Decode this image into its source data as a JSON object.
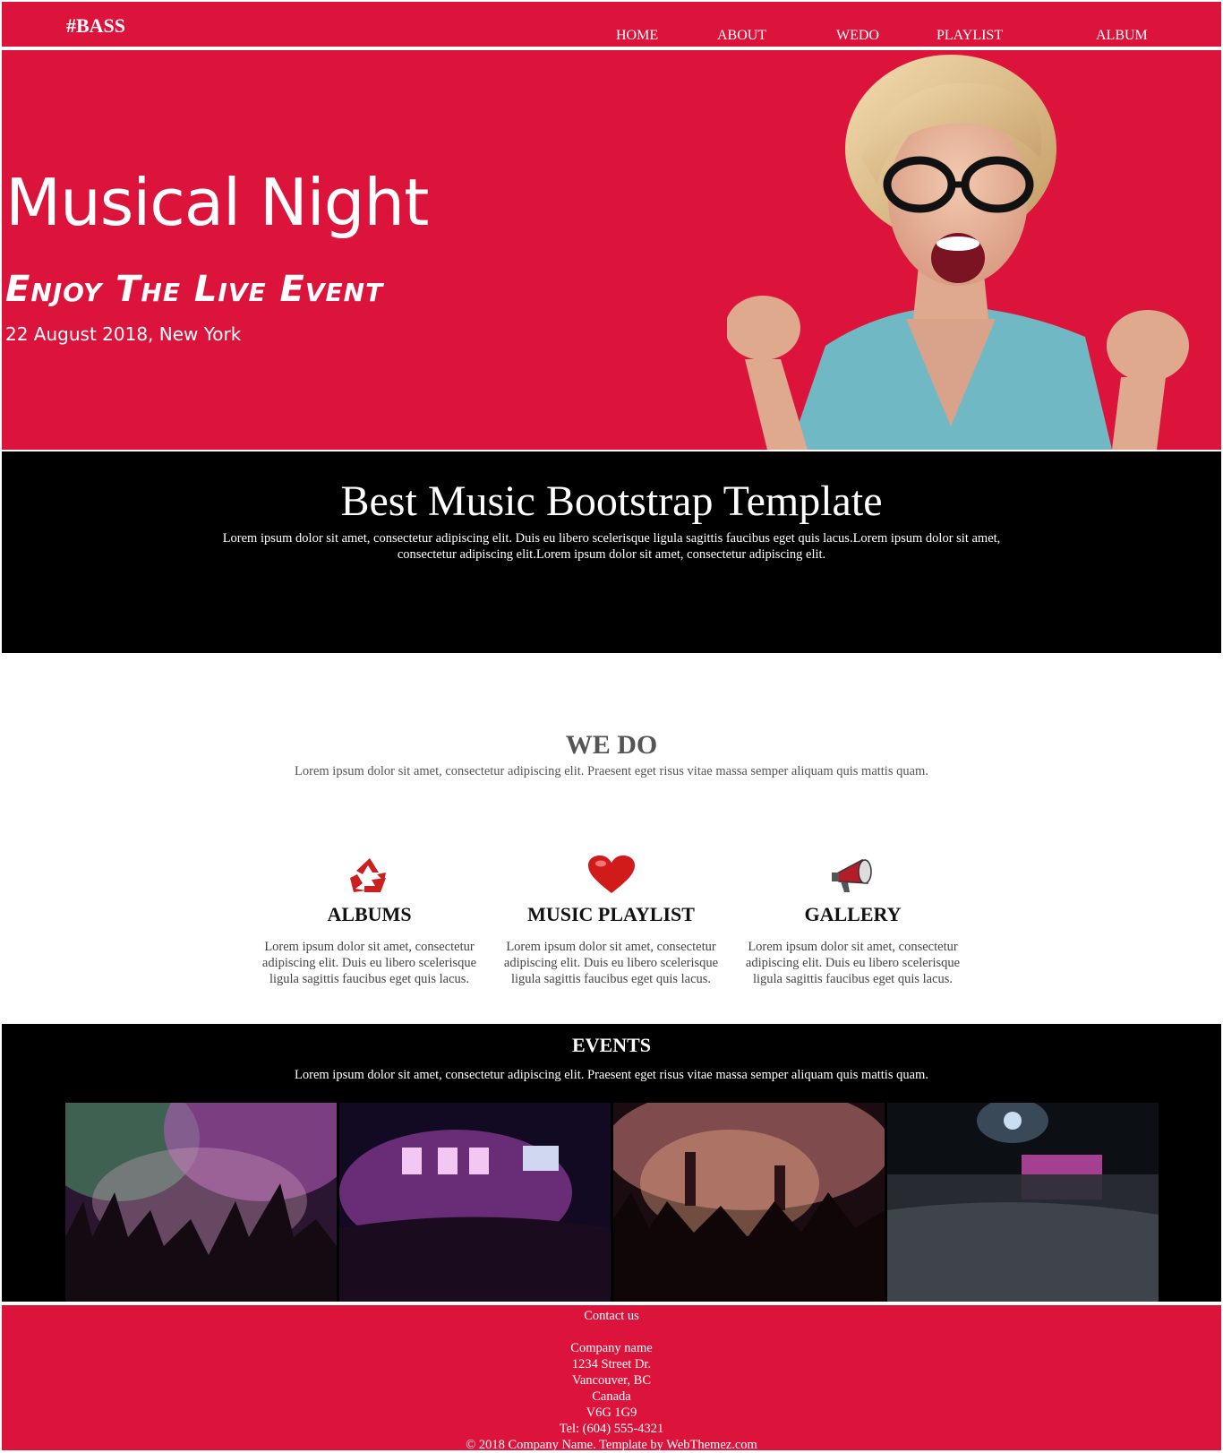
{
  "nav": {
    "brand": "#BASS",
    "links": [
      "HOME",
      "ABOUT",
      "WEDO",
      "PLAYLIST",
      "ALBUM"
    ]
  },
  "hero": {
    "title": "Musical Night",
    "subtitle": "Enjoy The Live Event",
    "date": "22 August 2018, New York"
  },
  "intro": {
    "title": "Best Music Bootstrap Template",
    "text": "Lorem ipsum dolor sit amet, consectetur adipiscing elit. Duis eu libero scelerisque ligula sagittis faucibus eget quis lacus.Lorem ipsum dolor sit amet, consectetur adipiscing elit.Lorem ipsum dolor sit amet, consectetur adipiscing elit."
  },
  "wedo": {
    "title": "WE DO",
    "text": "Lorem ipsum dolor sit amet, consectetur adipiscing elit. Praesent eget risus vitae massa semper aliquam quis mattis quam.",
    "features": [
      {
        "icon": "recycle-icon",
        "title": "ALBUMS",
        "text": "Lorem ipsum dolor sit amet, consectetur adipiscing elit. Duis eu libero scelerisque ligula sagittis faucibus eget quis lacus."
      },
      {
        "icon": "heart-icon",
        "title": "MUSIC PLAYLIST",
        "text": "Lorem ipsum dolor sit amet, consectetur adipiscing elit. Duis eu libero scelerisque ligula sagittis faucibus eget quis lacus."
      },
      {
        "icon": "megaphone-icon",
        "title": "GALLERY",
        "text": "Lorem ipsum dolor sit amet, consectetur adipiscing elit. Duis eu libero scelerisque ligula sagittis faucibus eget quis lacus."
      }
    ]
  },
  "events": {
    "title": "EVENTS",
    "text": "Lorem ipsum dolor sit amet, consectetur adipiscing elit. Praesent eget risus vitae massa semper aliquam quis mattis quam."
  },
  "footer": {
    "heading": "Contact us",
    "company": "Company name",
    "street": "1234 Street Dr.",
    "city": "Vancouver, BC",
    "country": "Canada",
    "postal": "V6G 1G9",
    "tel": "Tel: (604) 555-4321",
    "copyright": "© 2018 Company Name. Template by WebThemez.com"
  },
  "colors": {
    "brand_red": "#dc143c",
    "dark": "#000000",
    "text_grey": "#555555"
  }
}
